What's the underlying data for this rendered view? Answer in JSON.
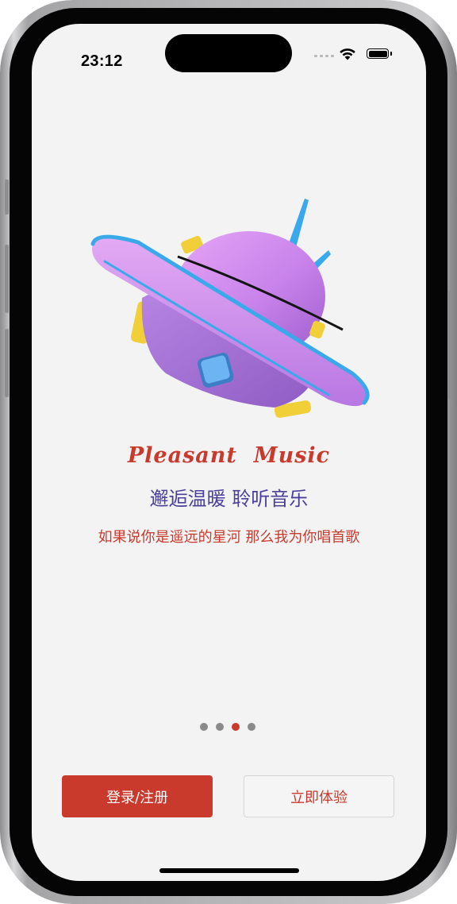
{
  "status_bar": {
    "time": "23:12",
    "icons": [
      "cellular-signal-icon",
      "wifi-icon",
      "battery-icon"
    ]
  },
  "onboarding": {
    "illustration": "ufo-illustration",
    "app_title": "Pleasant  Music",
    "slogan": "邂逅温暖 聆听音乐",
    "tagline": "如果说你是遥远的星河 那么我为你唱首歌",
    "pager": {
      "page_count": 4,
      "current_index": 2
    }
  },
  "actions": {
    "login_register_label": "登录/注册",
    "try_now_label": "立即体验"
  },
  "colors": {
    "accent_red": "#c93a2c",
    "slogan_purple": "#4b3f9c",
    "screen_background": "#f3f3f3",
    "inactive_dot": "#8a8a8a"
  }
}
